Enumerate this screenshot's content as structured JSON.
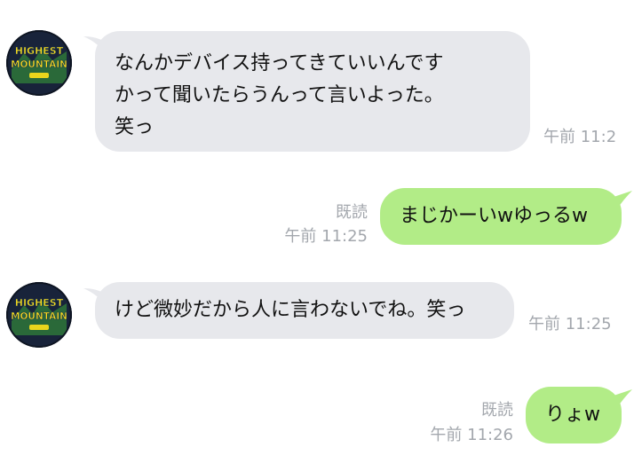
{
  "messages": [
    {
      "direction": "incoming",
      "lines": [
        "なんかデバイス持ってきていいんです",
        "かって聞いたらうんって言いよった。",
        "笑っ"
      ],
      "time": "午前 11:2"
    },
    {
      "direction": "outgoing",
      "text": "まじかーいwゆっるw",
      "read": "既読",
      "time": "午前 11:25"
    },
    {
      "direction": "incoming",
      "text": "けど微妙だから人に言わないでね。笑っ",
      "time": "午前 11:25"
    },
    {
      "direction": "outgoing",
      "text": "りょw",
      "read": "既読",
      "time": "午前 11:26"
    }
  ],
  "avatar": {
    "logo_lines": [
      "HIGHEST",
      "MOUNTAIN"
    ],
    "colors": {
      "text": "#ffe11a",
      "outline": "#17324f",
      "ring": "#0e1522"
    }
  },
  "colors": {
    "incoming_bubble": "#e7e8ec",
    "outgoing_bubble": "#b2ec87",
    "meta_text": "#a3a7ad"
  }
}
